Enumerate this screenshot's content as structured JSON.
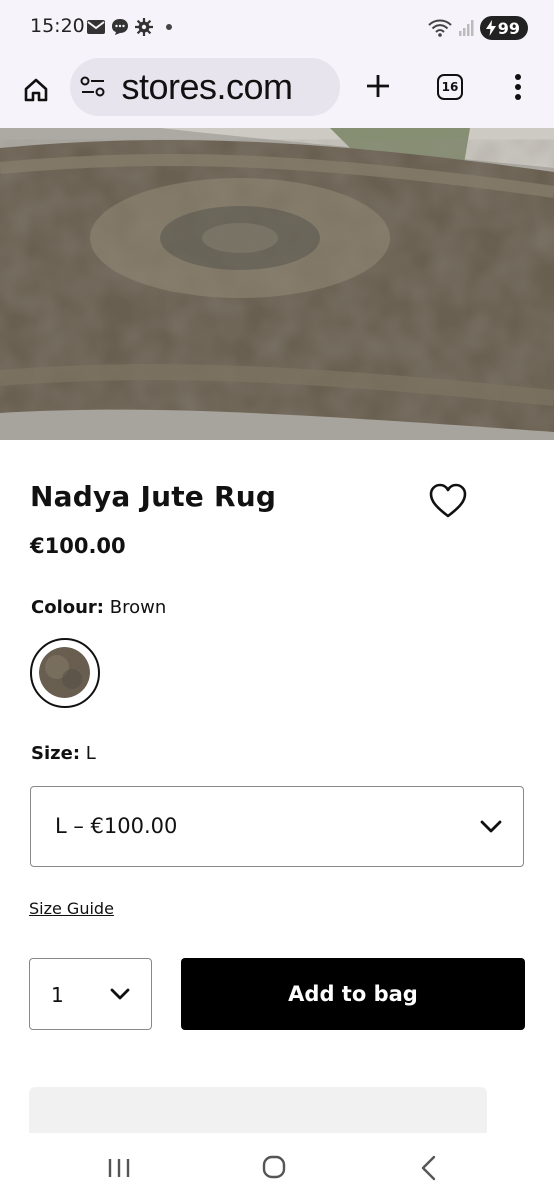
{
  "status_bar": {
    "time": "15:20",
    "battery_level": "99",
    "icons": [
      "mail-icon",
      "message-icon",
      "settings-icon",
      "dot-icon",
      "wifi-icon",
      "signal-icon",
      "battery-charging-icon"
    ]
  },
  "browser": {
    "url_display": " stores.com",
    "tab_count": "16",
    "icons": [
      "home-icon",
      "site-settings-icon",
      "plus-icon",
      "tabs-icon",
      "more-vertical-icon"
    ]
  },
  "product": {
    "title": "Nadya Jute Rug",
    "price": "€100.00",
    "colour_label": "Colour:",
    "colour_value": "Brown",
    "size_label": "Size:",
    "size_value": "L",
    "size_select_value": "L – €100.00",
    "size_guide_link": "Size Guide",
    "quantity": "1",
    "add_to_bag_label": "Add to bag"
  },
  "colors": {
    "accent": "#000000",
    "browser_bar": "#f6f3fa",
    "url_pill": "#e8e4ee",
    "rug_base": "#5a5449"
  },
  "nav_bar": {
    "icons": [
      "recents-icon",
      "home-circle-icon",
      "back-chevron-icon"
    ]
  }
}
